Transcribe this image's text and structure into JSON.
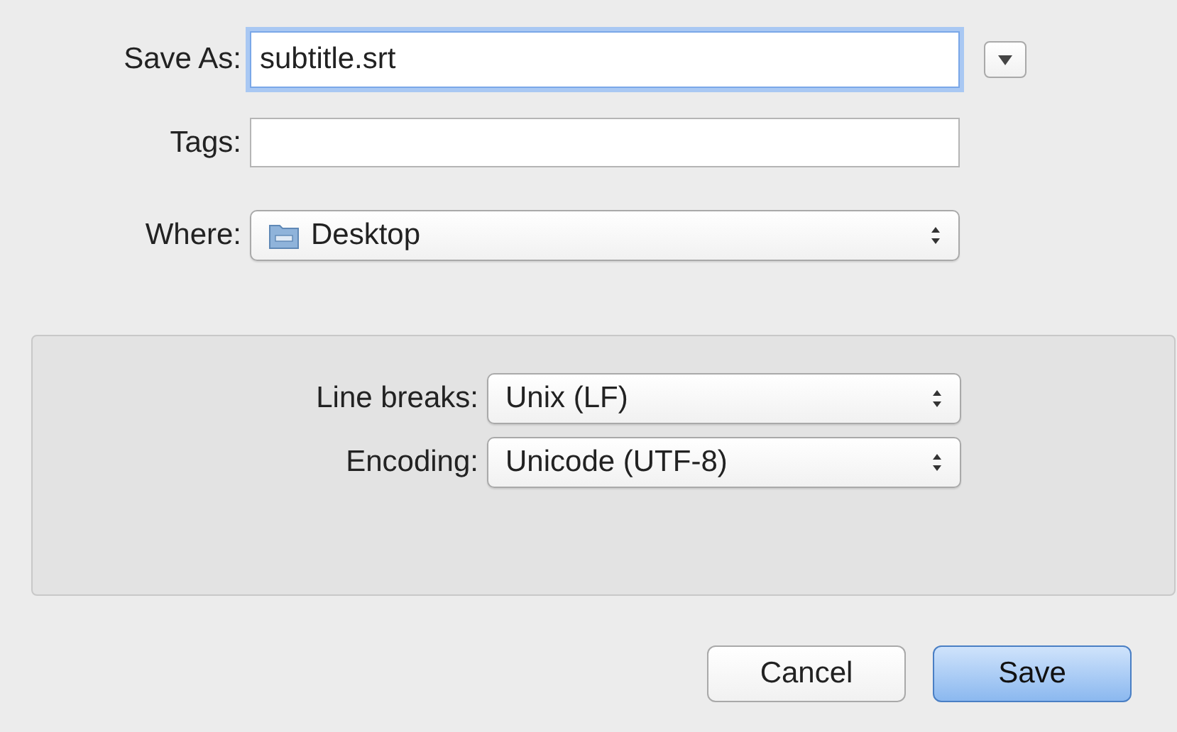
{
  "save_as": {
    "label": "Save As:",
    "value": "subtitle.srt",
    "focused": true
  },
  "tags": {
    "label": "Tags:"
  },
  "where": {
    "label": "Where:",
    "value": "Desktop"
  },
  "options": [
    {
      "label": "Line breaks:",
      "value": "Unix (LF)"
    },
    {
      "label": "Encoding:",
      "value": "Unicode (UTF-8)"
    }
  ],
  "buttons": [
    {
      "label": "Cancel",
      "default": false
    },
    {
      "label": "Save",
      "default": true
    }
  ]
}
